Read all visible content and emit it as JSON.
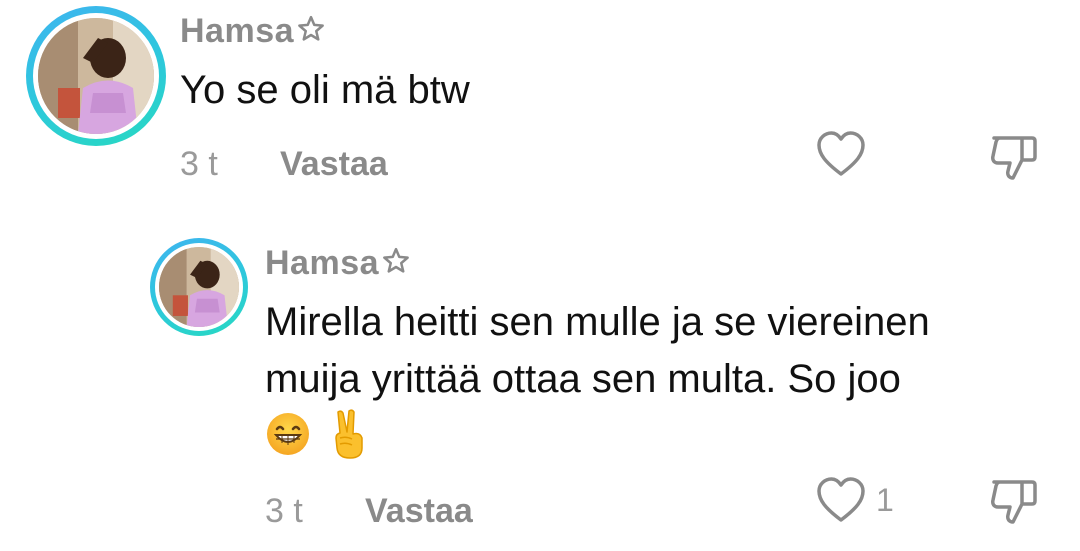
{
  "comments": [
    {
      "username": "Hamsa",
      "text_lines": [
        "Yo se oli mä btw"
      ],
      "time": "3 t",
      "reply_label": "Vastaa",
      "like_count": ""
    },
    {
      "username": "Hamsa",
      "text_lines": [
        "Mirella heitti sen mulle ja se viereinen",
        "muija yrittää ottaa sen multa. So joo"
      ],
      "emojis": [
        "grinning-face-emoji",
        "victory-hand-emoji"
      ],
      "time": "3 t",
      "reply_label": "Vastaa",
      "like_count": "1"
    }
  ],
  "icons": {
    "like": "heart-outline-icon",
    "dislike": "thumbs-down-outline-icon",
    "username_badge": "star-outline-icon"
  },
  "colors": {
    "avatar_ring_start": "#3fb4f0",
    "avatar_ring_end": "#27d9c1",
    "username": "#8a8a8a",
    "text": "#111111",
    "meta": "#9a9a9a"
  }
}
